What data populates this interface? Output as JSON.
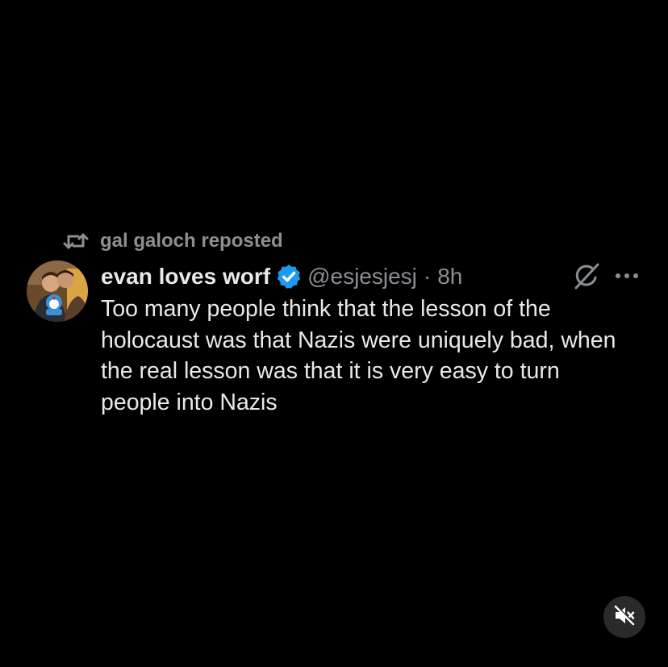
{
  "repost": {
    "label": "gal galoch reposted",
    "icon": "repost-icon"
  },
  "tweet": {
    "display_name": "evan loves worf",
    "verified_icon": "verified-badge-icon",
    "handle": "@esjesjesj",
    "separator": "·",
    "time": "8h",
    "text_lines": [
      "Too many people think that the lesson of the",
      "holocaust was that Nazis were uniquely bad, when",
      "the real lesson was that it is very easy to turn",
      "people into Nazis"
    ]
  },
  "actions": {
    "grok_icon": "grok-icon",
    "more_icon": "more-icon"
  },
  "video": {
    "mute_icon": "speaker-muted-icon"
  },
  "colors": {
    "background": "#000000",
    "text": "#e7e9ea",
    "muted_text": "#8b8f94",
    "verified_blue": "#1d9bf0",
    "mute_button_bg": "#2a2a2a"
  }
}
